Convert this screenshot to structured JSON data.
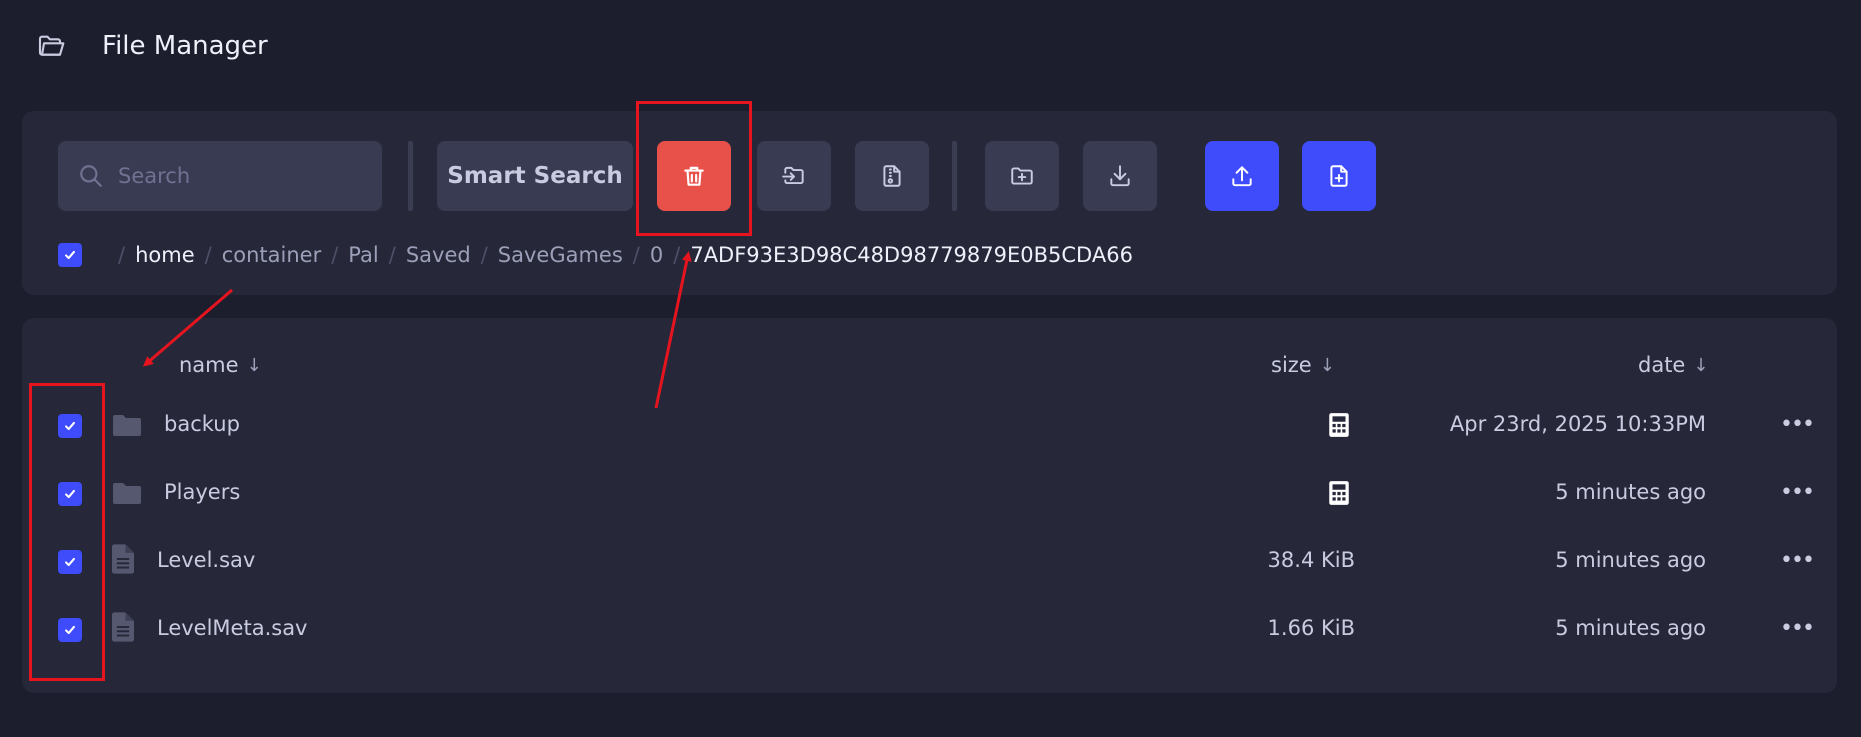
{
  "app": {
    "title": "File Manager"
  },
  "toolbar": {
    "search_placeholder": "Search",
    "smart_search_label": "Smart Search"
  },
  "breadcrumb": {
    "items": [
      "home",
      "container",
      "Pal",
      "Saved",
      "SaveGames",
      "0",
      "7ADF93E3D98C48D98779879E0B5CDA66"
    ]
  },
  "columns": {
    "name": "name",
    "size": "size",
    "date": "date"
  },
  "files": [
    {
      "name": "backup",
      "type": "folder",
      "size": "",
      "date": "Apr 23rd, 2025 10:33PM"
    },
    {
      "name": "Players",
      "type": "folder",
      "size": "",
      "date": "5 minutes ago"
    },
    {
      "name": "Level.sav",
      "type": "file",
      "size": "38.4 KiB",
      "date": "5 minutes ago"
    },
    {
      "name": "LevelMeta.sav",
      "type": "file",
      "size": "1.66 KiB",
      "date": "5 minutes ago"
    }
  ],
  "icons": {
    "app": "folder-open-icon",
    "delete": "trash-icon",
    "move": "move-icon",
    "archive": "archive-icon",
    "new_folder": "folder-plus-icon",
    "download": "download-icon",
    "upload": "upload-icon",
    "new_file": "file-plus-icon"
  },
  "colors": {
    "background": "#1c1d2d",
    "panel": "#262839",
    "accent": "#3f4cfb",
    "danger": "#e8504a",
    "annotation": "#e5141f"
  }
}
